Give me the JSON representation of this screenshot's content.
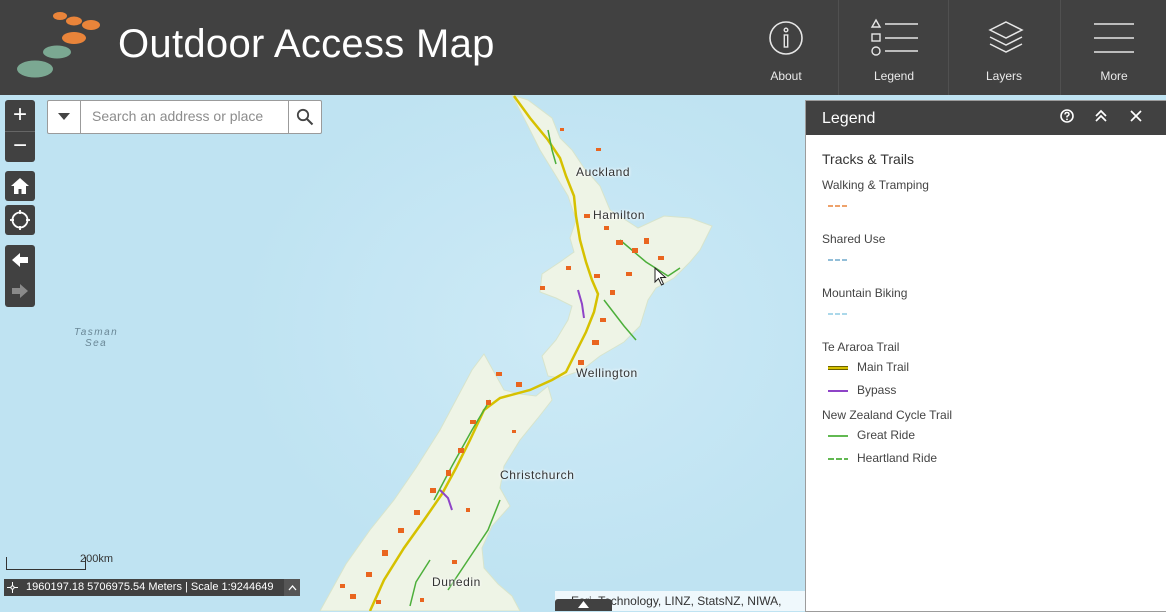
{
  "app": {
    "title": "Outdoor Access Map",
    "brand_colors": [
      "#e9843a",
      "#7ba892"
    ]
  },
  "nav": [
    {
      "label": "About",
      "icon": "info-icon"
    },
    {
      "label": "Legend",
      "icon": "legend-list-icon"
    },
    {
      "label": "Layers",
      "icon": "layers-icon"
    },
    {
      "label": "More",
      "icon": "hamburger-menu-icon"
    }
  ],
  "map_controls": {
    "zoom_in": "+",
    "zoom_out": "−",
    "home_icon": "home-icon",
    "locate_icon": "locate-icon",
    "back_icon": "arrow-left-icon",
    "forward_icon": "arrow-right-icon"
  },
  "search": {
    "placeholder": "Search an address or place",
    "value": ""
  },
  "places": [
    "Auckland",
    "Hamilton",
    "Wellington",
    "Christchurch",
    "Dunedin"
  ],
  "seas": [
    "Tasman",
    "Sea"
  ],
  "legend": {
    "title": "Legend",
    "section": "Tracks & Trails",
    "groups": [
      {
        "name": "Walking & Tramping",
        "items": [
          {
            "label": "",
            "color": "#e9843a",
            "style": "dashed"
          }
        ]
      },
      {
        "name": "Shared Use",
        "items": [
          {
            "label": "",
            "color": "#6ea9cc",
            "style": "dashed"
          }
        ]
      },
      {
        "name": "Mountain Biking",
        "items": [
          {
            "label": "",
            "color": "#8fcbe3",
            "style": "dashed"
          }
        ]
      },
      {
        "name": "Te Araroa Trail",
        "items": [
          {
            "label": "Main Trail",
            "color": "#d6c100",
            "style": "double"
          },
          {
            "label": "Bypass",
            "color": "#8e44c7",
            "style": "solid"
          }
        ]
      },
      {
        "name": "New Zealand Cycle Trail",
        "items": [
          {
            "label": "Great Ride",
            "color": "#4caf3a",
            "style": "solid"
          },
          {
            "label": "Heartland Ride",
            "color": "#4caf3a",
            "style": "dashed"
          }
        ]
      }
    ]
  },
  "scale": {
    "bar_label": "200km",
    "status": "1960197.18 5706975.54 Meters | Scale 1:9244649"
  },
  "attribution": "Esri, Technology, LINZ, StatsNZ, NIWA,"
}
